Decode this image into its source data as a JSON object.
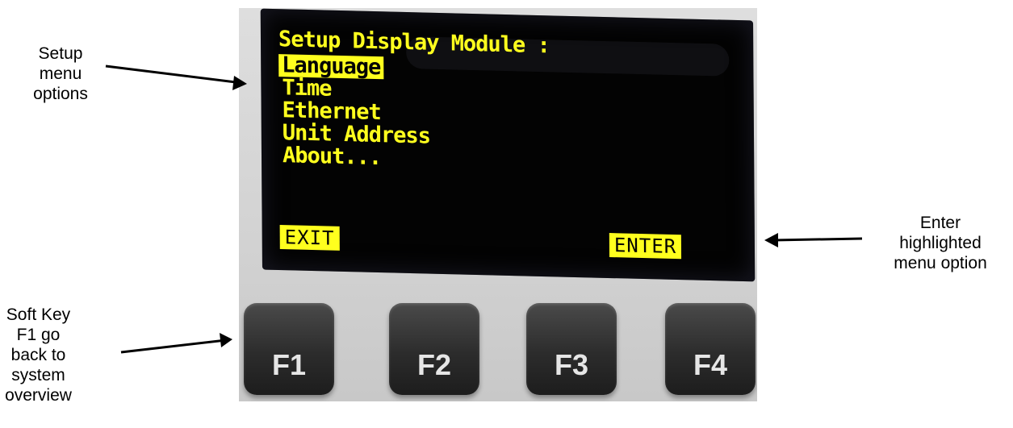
{
  "annotations": {
    "setup_menu": [
      "Setup",
      "menu",
      "options"
    ],
    "enter_option": [
      "Enter",
      "highlighted",
      "menu option"
    ],
    "soft_key_f1": [
      "Soft Key",
      "F1 go",
      "back to",
      "system",
      "overview"
    ]
  },
  "display": {
    "title": "Setup Display Module :",
    "menu": [
      {
        "label": "Language",
        "selected": true
      },
      {
        "label": "Time",
        "selected": false
      },
      {
        "label": "Ethernet",
        "selected": false
      },
      {
        "label": "Unit Address",
        "selected": false
      },
      {
        "label": "About...",
        "selected": false
      }
    ],
    "softkeys": {
      "left": "EXIT",
      "right": "ENTER"
    },
    "colors": {
      "text": "#ffff1e",
      "background": "#030303"
    }
  },
  "keys": [
    "F1",
    "F2",
    "F3",
    "F4"
  ]
}
